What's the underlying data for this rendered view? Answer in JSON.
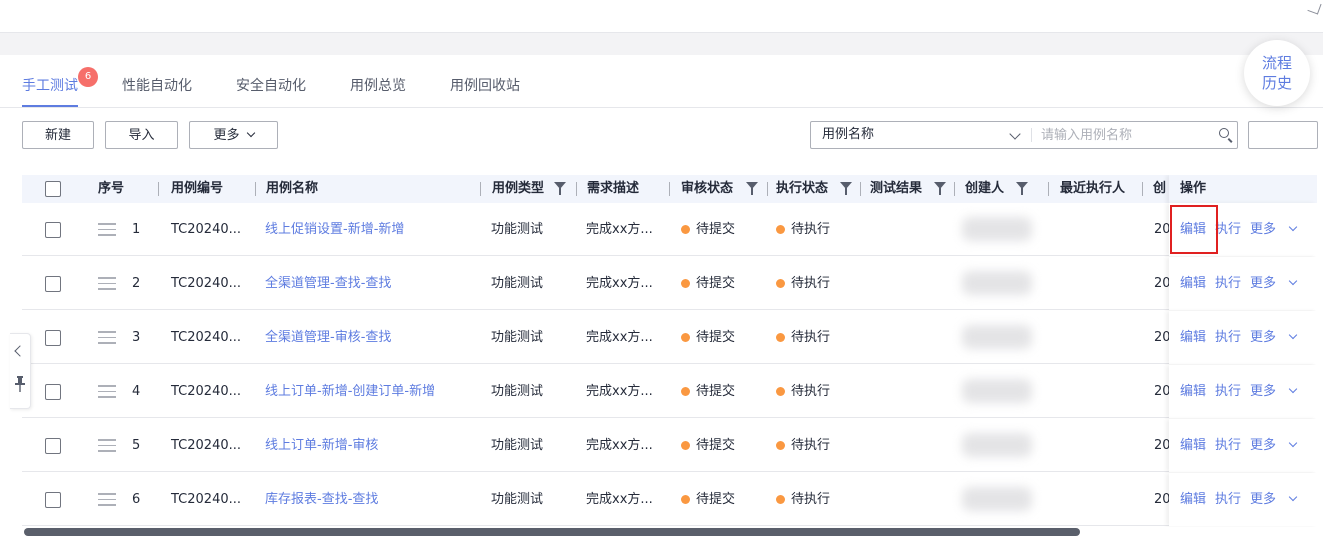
{
  "tabs": [
    {
      "label": "手工测试",
      "badge": "6",
      "active": true
    },
    {
      "label": "性能自动化"
    },
    {
      "label": "安全自动化"
    },
    {
      "label": "用例总览"
    },
    {
      "label": "用例回收站"
    }
  ],
  "toolbar": {
    "new_label": "新建",
    "import_label": "导入",
    "more_label": "更多"
  },
  "search": {
    "field_selected": "用例名称",
    "placeholder": "请输入用例名称"
  },
  "float_button": {
    "line1": "流程",
    "line2": "历史"
  },
  "table": {
    "columns": {
      "seq": "序号",
      "case_id": "用例编号",
      "case_name": "用例名称",
      "case_type": "用例类型",
      "requirement": "需求描述",
      "review_status": "审核状态",
      "exec_status": "执行状态",
      "test_result": "测试结果",
      "creator": "创建人",
      "last_executor": "最近执行人",
      "created_partial": "创",
      "actions": "操作"
    },
    "rows": [
      {
        "seq": "1",
        "id": "TC20240...",
        "name": "线上促销设置-新增-新增",
        "type": "功能测试",
        "desc": "完成xx方...",
        "review": "待提交",
        "exec": "待执行",
        "created": "20"
      },
      {
        "seq": "2",
        "id": "TC20240...",
        "name": "全渠道管理-查找-查找",
        "type": "功能测试",
        "desc": "完成xx方...",
        "review": "待提交",
        "exec": "待执行",
        "created": "20"
      },
      {
        "seq": "3",
        "id": "TC20240...",
        "name": "全渠道管理-审核-查找",
        "type": "功能测试",
        "desc": "完成xx方...",
        "review": "待提交",
        "exec": "待执行",
        "created": "20"
      },
      {
        "seq": "4",
        "id": "TC20240...",
        "name": "线上订单-新增-创建订单-新增",
        "type": "功能测试",
        "desc": "完成xx方...",
        "review": "待提交",
        "exec": "待执行",
        "created": "20"
      },
      {
        "seq": "5",
        "id": "TC20240...",
        "name": "线上订单-新增-审核",
        "type": "功能测试",
        "desc": "完成xx方...",
        "review": "待提交",
        "exec": "待执行",
        "created": "20"
      },
      {
        "seq": "6",
        "id": "TC20240...",
        "name": "库存报表-查找-查找",
        "type": "功能测试",
        "desc": "完成xx方...",
        "review": "待提交",
        "exec": "待执行",
        "created": "20"
      }
    ],
    "actions": {
      "edit": "编辑",
      "execute": "执行",
      "more": "更多"
    }
  },
  "colors": {
    "primary": "#5e7ce0",
    "status_dot": "#fa9841",
    "badge": "#f66f6a",
    "highlight": "#e02020"
  }
}
